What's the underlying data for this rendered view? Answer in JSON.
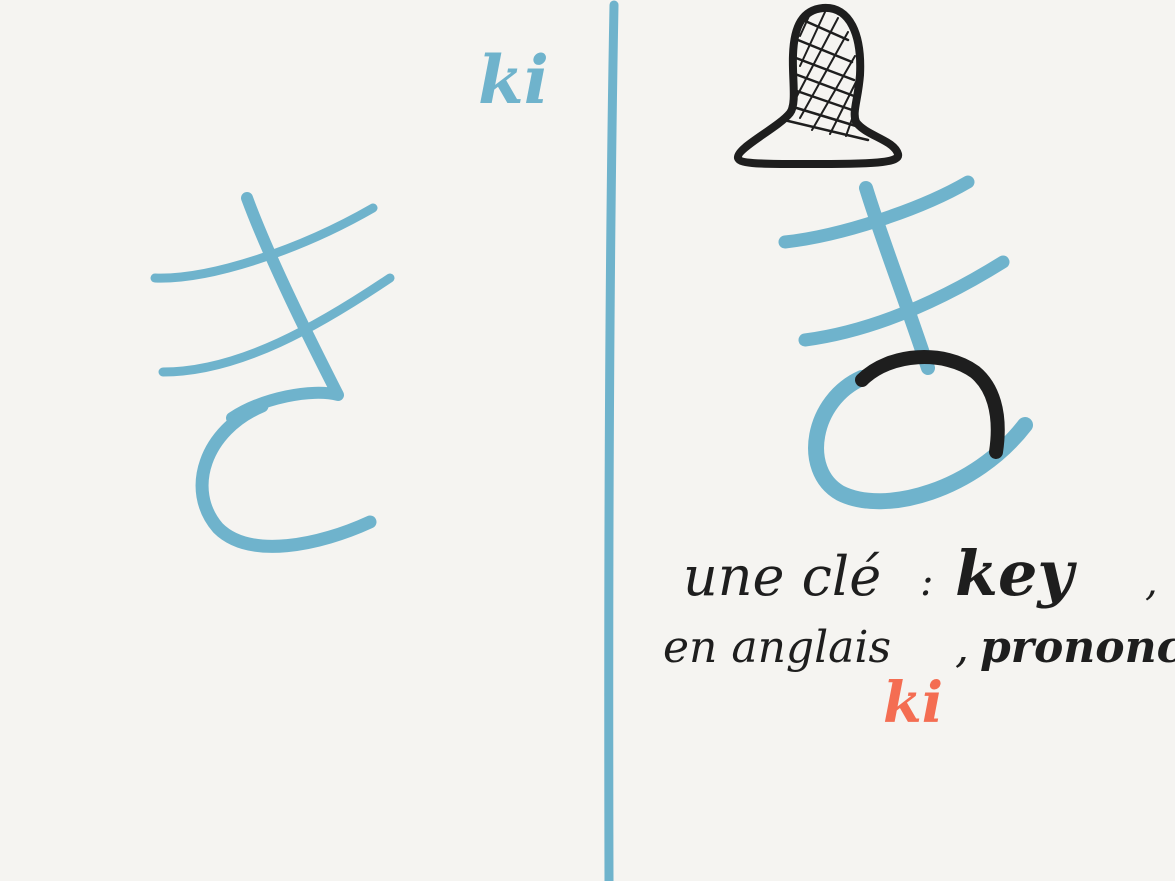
{
  "colors": {
    "background": "#f5f4f1",
    "blue": "#6fb3cc",
    "ink": "#1e1e1e",
    "accent": "#f46d52"
  },
  "left_panel": {
    "romaji": "ki",
    "kana": "き"
  },
  "right_panel": {
    "mnemonic_object": "key-icon",
    "kana": "き",
    "line_1_a": "une clé",
    "line_1_sep": ":",
    "line_1_b": "key",
    "line_1_end": ",",
    "line_2_a": "en anglais",
    "line_2_sep": ",",
    "line_2_b": "prononcé",
    "line_3": "ki"
  }
}
